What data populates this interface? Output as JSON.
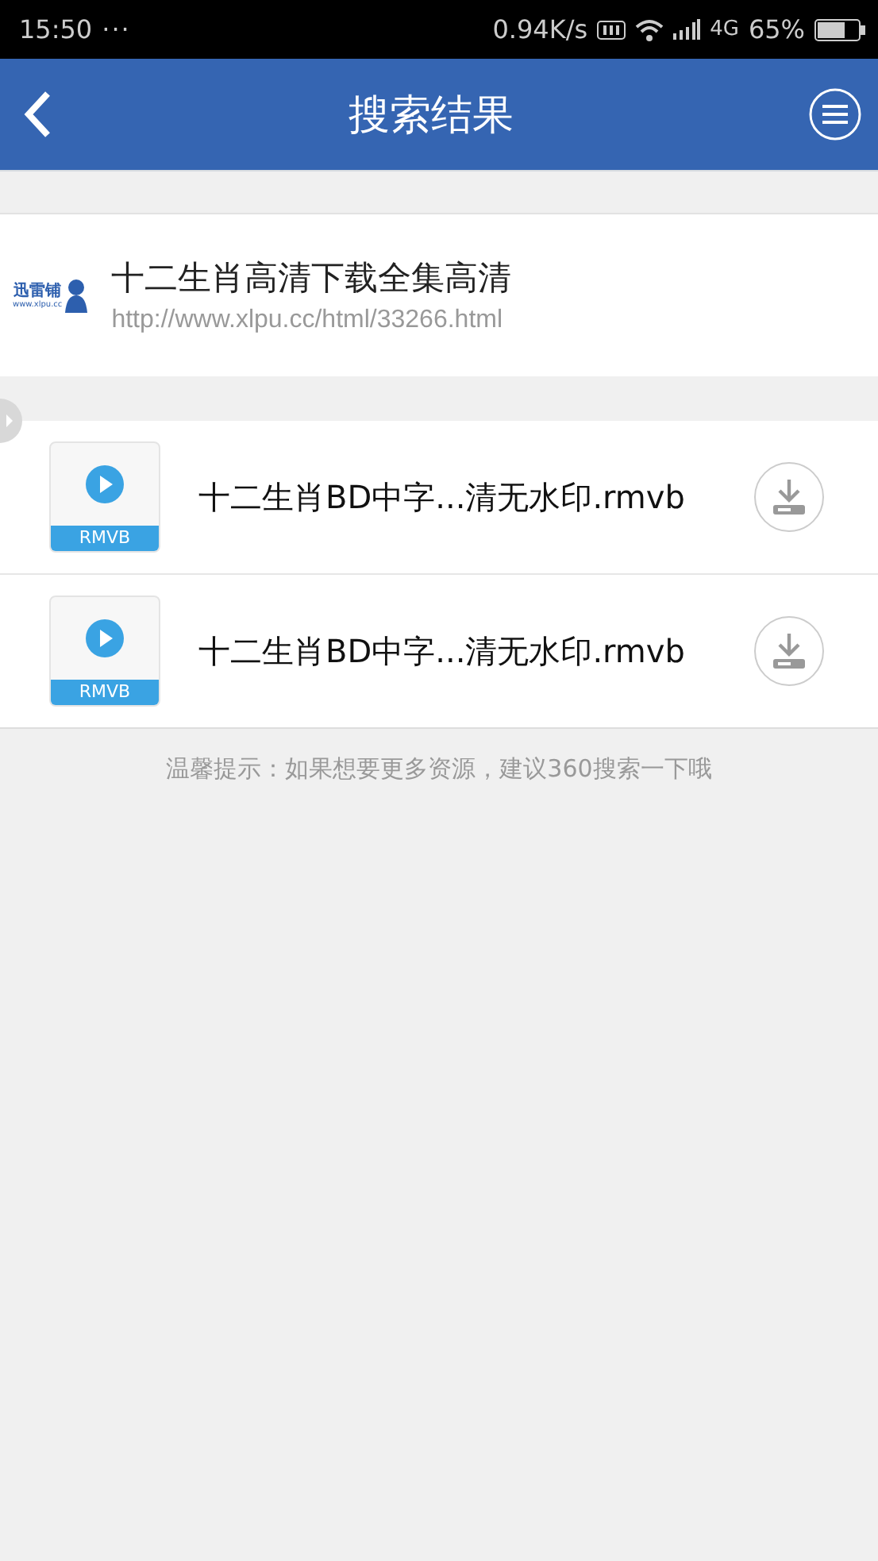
{
  "status_bar": {
    "time": "15:50",
    "dots": "···",
    "speed": "0.94K/s",
    "network": "4G",
    "battery": "65%"
  },
  "header": {
    "title": "搜索结果"
  },
  "source": {
    "logo_name": "迅雷铺",
    "logo_url": "www.xlpu.cc",
    "title": "十二生肖高清下载全集高清",
    "url": "http://www.xlpu.cc/html/33266.html"
  },
  "files": [
    {
      "type": "RMVB",
      "name": "十二生肖BD中字...清无水印.rmvb"
    },
    {
      "type": "RMVB",
      "name": "十二生肖BD中字...清无水印.rmvb"
    }
  ],
  "hint": "温馨提示：如果想要更多资源，建议360搜索一下哦"
}
